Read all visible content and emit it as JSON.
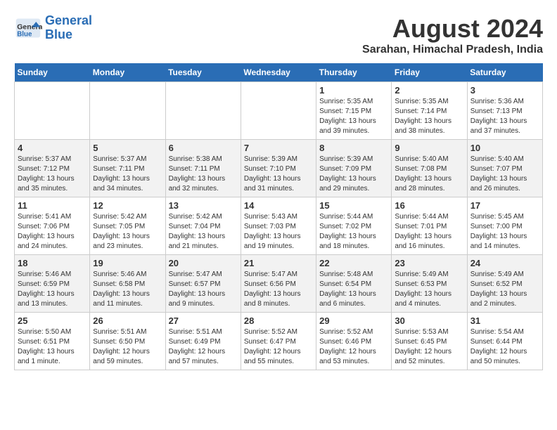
{
  "header": {
    "logo_line1": "General",
    "logo_line2": "Blue",
    "month_year": "August 2024",
    "location": "Sarahan, Himachal Pradesh, India"
  },
  "days_of_week": [
    "Sunday",
    "Monday",
    "Tuesday",
    "Wednesday",
    "Thursday",
    "Friday",
    "Saturday"
  ],
  "weeks": [
    [
      {
        "day": "",
        "info": ""
      },
      {
        "day": "",
        "info": ""
      },
      {
        "day": "",
        "info": ""
      },
      {
        "day": "",
        "info": ""
      },
      {
        "day": "1",
        "info": "Sunrise: 5:35 AM\nSunset: 7:15 PM\nDaylight: 13 hours\nand 39 minutes."
      },
      {
        "day": "2",
        "info": "Sunrise: 5:35 AM\nSunset: 7:14 PM\nDaylight: 13 hours\nand 38 minutes."
      },
      {
        "day": "3",
        "info": "Sunrise: 5:36 AM\nSunset: 7:13 PM\nDaylight: 13 hours\nand 37 minutes."
      }
    ],
    [
      {
        "day": "4",
        "info": "Sunrise: 5:37 AM\nSunset: 7:12 PM\nDaylight: 13 hours\nand 35 minutes."
      },
      {
        "day": "5",
        "info": "Sunrise: 5:37 AM\nSunset: 7:11 PM\nDaylight: 13 hours\nand 34 minutes."
      },
      {
        "day": "6",
        "info": "Sunrise: 5:38 AM\nSunset: 7:11 PM\nDaylight: 13 hours\nand 32 minutes."
      },
      {
        "day": "7",
        "info": "Sunrise: 5:39 AM\nSunset: 7:10 PM\nDaylight: 13 hours\nand 31 minutes."
      },
      {
        "day": "8",
        "info": "Sunrise: 5:39 AM\nSunset: 7:09 PM\nDaylight: 13 hours\nand 29 minutes."
      },
      {
        "day": "9",
        "info": "Sunrise: 5:40 AM\nSunset: 7:08 PM\nDaylight: 13 hours\nand 28 minutes."
      },
      {
        "day": "10",
        "info": "Sunrise: 5:40 AM\nSunset: 7:07 PM\nDaylight: 13 hours\nand 26 minutes."
      }
    ],
    [
      {
        "day": "11",
        "info": "Sunrise: 5:41 AM\nSunset: 7:06 PM\nDaylight: 13 hours\nand 24 minutes."
      },
      {
        "day": "12",
        "info": "Sunrise: 5:42 AM\nSunset: 7:05 PM\nDaylight: 13 hours\nand 23 minutes."
      },
      {
        "day": "13",
        "info": "Sunrise: 5:42 AM\nSunset: 7:04 PM\nDaylight: 13 hours\nand 21 minutes."
      },
      {
        "day": "14",
        "info": "Sunrise: 5:43 AM\nSunset: 7:03 PM\nDaylight: 13 hours\nand 19 minutes."
      },
      {
        "day": "15",
        "info": "Sunrise: 5:44 AM\nSunset: 7:02 PM\nDaylight: 13 hours\nand 18 minutes."
      },
      {
        "day": "16",
        "info": "Sunrise: 5:44 AM\nSunset: 7:01 PM\nDaylight: 13 hours\nand 16 minutes."
      },
      {
        "day": "17",
        "info": "Sunrise: 5:45 AM\nSunset: 7:00 PM\nDaylight: 13 hours\nand 14 minutes."
      }
    ],
    [
      {
        "day": "18",
        "info": "Sunrise: 5:46 AM\nSunset: 6:59 PM\nDaylight: 13 hours\nand 13 minutes."
      },
      {
        "day": "19",
        "info": "Sunrise: 5:46 AM\nSunset: 6:58 PM\nDaylight: 13 hours\nand 11 minutes."
      },
      {
        "day": "20",
        "info": "Sunrise: 5:47 AM\nSunset: 6:57 PM\nDaylight: 13 hours\nand 9 minutes."
      },
      {
        "day": "21",
        "info": "Sunrise: 5:47 AM\nSunset: 6:56 PM\nDaylight: 13 hours\nand 8 minutes."
      },
      {
        "day": "22",
        "info": "Sunrise: 5:48 AM\nSunset: 6:54 PM\nDaylight: 13 hours\nand 6 minutes."
      },
      {
        "day": "23",
        "info": "Sunrise: 5:49 AM\nSunset: 6:53 PM\nDaylight: 13 hours\nand 4 minutes."
      },
      {
        "day": "24",
        "info": "Sunrise: 5:49 AM\nSunset: 6:52 PM\nDaylight: 13 hours\nand 2 minutes."
      }
    ],
    [
      {
        "day": "25",
        "info": "Sunrise: 5:50 AM\nSunset: 6:51 PM\nDaylight: 13 hours\nand 1 minute."
      },
      {
        "day": "26",
        "info": "Sunrise: 5:51 AM\nSunset: 6:50 PM\nDaylight: 12 hours\nand 59 minutes."
      },
      {
        "day": "27",
        "info": "Sunrise: 5:51 AM\nSunset: 6:49 PM\nDaylight: 12 hours\nand 57 minutes."
      },
      {
        "day": "28",
        "info": "Sunrise: 5:52 AM\nSunset: 6:47 PM\nDaylight: 12 hours\nand 55 minutes."
      },
      {
        "day": "29",
        "info": "Sunrise: 5:52 AM\nSunset: 6:46 PM\nDaylight: 12 hours\nand 53 minutes."
      },
      {
        "day": "30",
        "info": "Sunrise: 5:53 AM\nSunset: 6:45 PM\nDaylight: 12 hours\nand 52 minutes."
      },
      {
        "day": "31",
        "info": "Sunrise: 5:54 AM\nSunset: 6:44 PM\nDaylight: 12 hours\nand 50 minutes."
      }
    ]
  ]
}
